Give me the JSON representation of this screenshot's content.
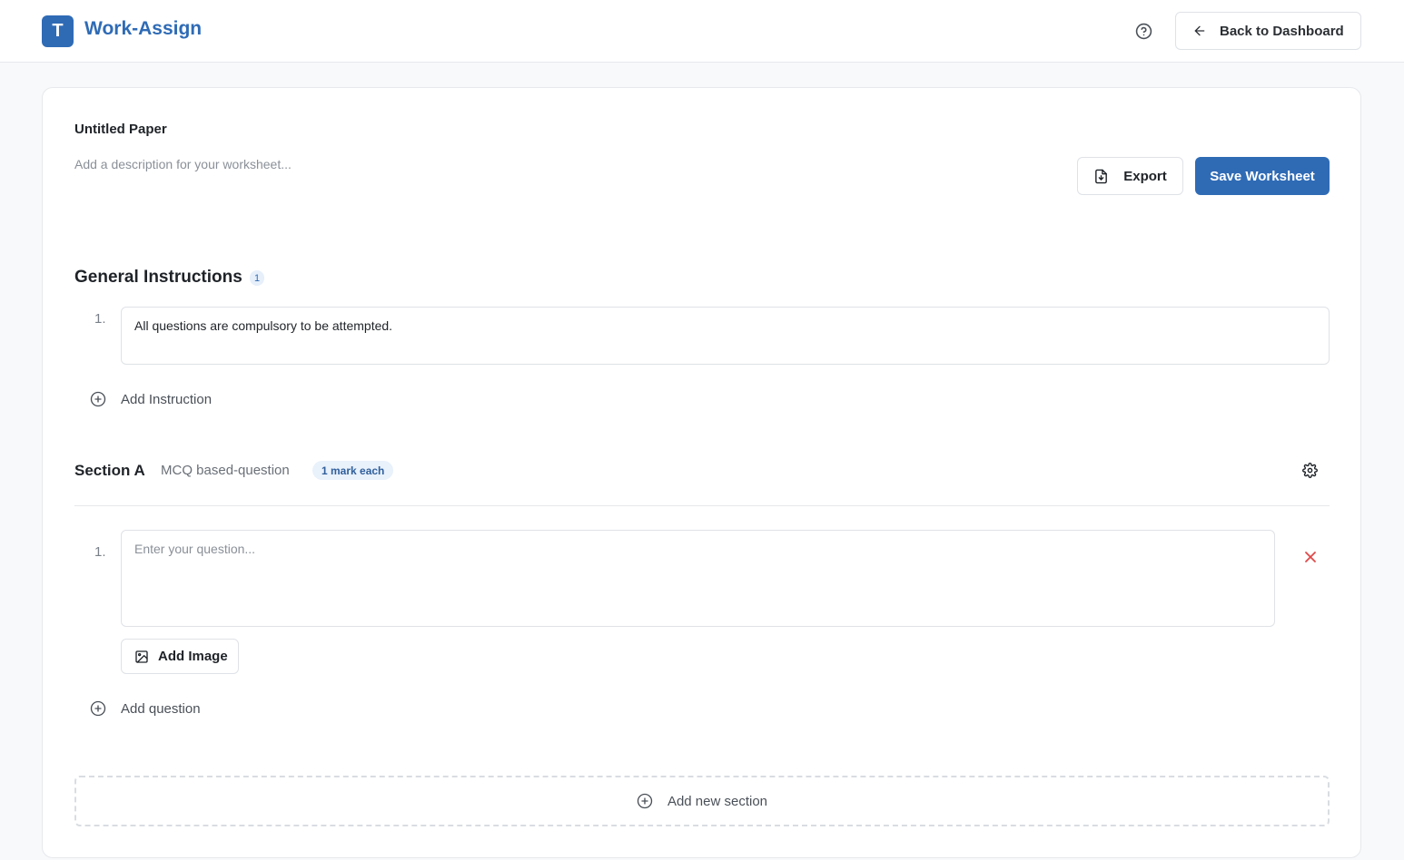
{
  "header": {
    "logo_letter": "T",
    "app_title": "Work-Assign",
    "back_label": "Back to Dashboard"
  },
  "paper": {
    "title": "Untitled Paper",
    "description_placeholder": "Add a description for your worksheet...",
    "export_label": "Export",
    "save_label": "Save Worksheet"
  },
  "instructions": {
    "title": "General Instructions",
    "count": "1",
    "items": [
      {
        "number": "1.",
        "text": "All questions are compulsory to be attempted."
      }
    ],
    "add_label": "Add Instruction"
  },
  "section": {
    "title": "Section A",
    "subtitle": "MCQ based-question",
    "badge": "1 mark each",
    "questions": [
      {
        "number": "1.",
        "placeholder": "Enter your question..."
      }
    ],
    "add_image_label": "Add Image",
    "add_question_label": "Add question"
  },
  "add_section_label": "Add new section",
  "icons": {
    "help": "help-circle-icon",
    "back": "arrow-left-icon",
    "export": "file-download-icon",
    "add": "plus-circle-icon",
    "settings": "gear-icon",
    "delete": "close-icon",
    "image": "image-icon"
  },
  "colors": {
    "accent": "#2f6bb5",
    "delete": "#e04848"
  }
}
